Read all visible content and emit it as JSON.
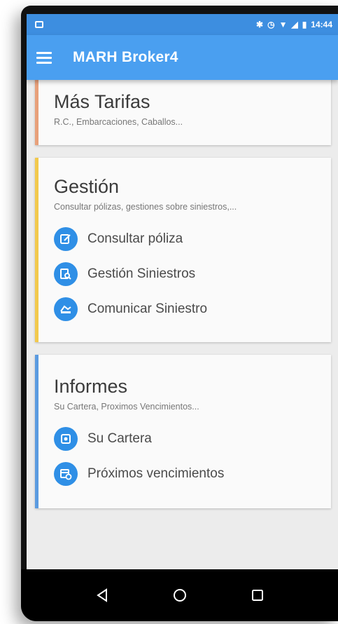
{
  "status_bar": {
    "time": "14:44"
  },
  "app_bar": {
    "title": "MARH Broker4",
    "menu_icon": "hamburger-menu-icon"
  },
  "cards": {
    "tarifas": {
      "title": "Más Tarifas",
      "subtitle": "R.C., Embarcaciones, Caballos...",
      "accent": "#e8a07a"
    },
    "gestion": {
      "title": "Gestión",
      "subtitle": "Consultar pólizas, gestiones sobre siniestros,...",
      "accent": "#f2c94c",
      "items": [
        {
          "label": "Consultar póliza",
          "icon": "edit-document-icon"
        },
        {
          "label": "Gestión Siniestros",
          "icon": "document-search-icon"
        },
        {
          "label": "Comunicar Siniestro",
          "icon": "car-accident-icon"
        }
      ]
    },
    "informes": {
      "title": "Informes",
      "subtitle": "Su Cartera, Proximos Vencimientos...",
      "accent": "#5b9be0",
      "items": [
        {
          "label": "Su Cartera",
          "icon": "portfolio-icon"
        },
        {
          "label": "Próximos vencimientos",
          "icon": "calendar-clock-icon"
        }
      ]
    }
  },
  "colors": {
    "app_bar": "#4a9ff0",
    "status_bar": "#3d8ee0",
    "icon_circle": "#2f8fe6"
  }
}
